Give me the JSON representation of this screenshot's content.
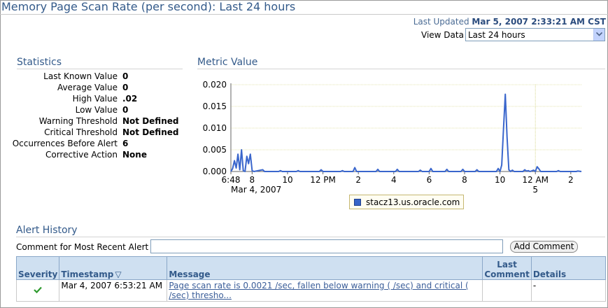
{
  "page": {
    "title": "Memory Page Scan Rate (per second): Last 24 hours",
    "last_updated_label": "Last Updated",
    "last_updated_value": "Mar 5, 2007 2:33:21 AM CST",
    "view_data_label": "View Data",
    "view_data_selected": "Last 24 hours"
  },
  "statistics": {
    "heading": "Statistics",
    "rows": [
      {
        "label": "Last Known Value",
        "value": "0"
      },
      {
        "label": "Average Value",
        "value": "0"
      },
      {
        "label": "High Value",
        "value": ".02"
      },
      {
        "label": "Low Value",
        "value": "0"
      },
      {
        "label": "Warning Threshold",
        "value": "Not Defined"
      },
      {
        "label": "Critical Threshold",
        "value": "Not Defined"
      },
      {
        "label": "Occurrences Before Alert",
        "value": "6"
      },
      {
        "label": "Corrective Action",
        "value": "None"
      }
    ]
  },
  "metric": {
    "heading": "Metric Value"
  },
  "chart_data": {
    "type": "line",
    "title": "",
    "xlabel": "",
    "ylabel": "",
    "ylim": [
      0,
      0.02
    ],
    "yticks": [
      "0.020",
      "0.015",
      "0.010",
      "0.005",
      "0.000"
    ],
    "xtick_labels": [
      {
        "top": "6:48",
        "bottom": "Mar 4, 2007",
        "hour": 6.8
      },
      {
        "top": "8",
        "bottom": "",
        "hour": 8
      },
      {
        "top": "10",
        "bottom": "",
        "hour": 10
      },
      {
        "top": "12 PM",
        "bottom": "",
        "hour": 12
      },
      {
        "top": "2",
        "bottom": "",
        "hour": 14
      },
      {
        "top": "4",
        "bottom": "",
        "hour": 16
      },
      {
        "top": "6",
        "bottom": "",
        "hour": 18
      },
      {
        "top": "8",
        "bottom": "",
        "hour": 20
      },
      {
        "top": "10",
        "bottom": "",
        "hour": 22
      },
      {
        "top": "12 AM",
        "bottom": "5",
        "hour": 24
      },
      {
        "top": "2",
        "bottom": "",
        "hour": 26
      }
    ],
    "xlim_hours": [
      6.8,
      26.6
    ],
    "day_marker_hour": 24,
    "legend_position": "bottom",
    "grid": true,
    "series": [
      {
        "name": "stacz13.us.oracle.com",
        "color": "#3a66cc",
        "points": [
          [
            6.8,
            0
          ],
          [
            6.9,
            0.0007
          ],
          [
            7.0,
            0.0025
          ],
          [
            7.1,
            0.0008
          ],
          [
            7.2,
            0.004
          ],
          [
            7.3,
            0.0004
          ],
          [
            7.4,
            0.005
          ],
          [
            7.5,
            0.0002
          ],
          [
            7.6,
            0
          ],
          [
            7.7,
            0.0035
          ],
          [
            7.8,
            0.0018
          ],
          [
            7.9,
            0.004
          ],
          [
            8.0,
            0.0002
          ],
          [
            8.1,
            0
          ],
          [
            8.6,
            0.0004
          ],
          [
            8.7,
            0
          ],
          [
            9.5,
            0
          ],
          [
            9.6,
            0.0002
          ],
          [
            9.7,
            0
          ],
          [
            10.5,
            0
          ],
          [
            10.6,
            0.0002
          ],
          [
            10.7,
            0
          ],
          [
            11.8,
            0
          ],
          [
            11.9,
            0.0004
          ],
          [
            12.0,
            0
          ],
          [
            13.0,
            0
          ],
          [
            13.1,
            0.0002
          ],
          [
            13.2,
            0
          ],
          [
            13.7,
            0
          ],
          [
            13.8,
            0.0009
          ],
          [
            13.9,
            0
          ],
          [
            15.0,
            0
          ],
          [
            15.1,
            0.0005
          ],
          [
            15.2,
            0
          ],
          [
            16.1,
            0
          ],
          [
            16.2,
            0.0005
          ],
          [
            16.3,
            0
          ],
          [
            17.4,
            0
          ],
          [
            17.5,
            0.0003
          ],
          [
            17.6,
            0
          ],
          [
            18.0,
            0
          ],
          [
            18.1,
            0.0007
          ],
          [
            18.2,
            0
          ],
          [
            18.9,
            0
          ],
          [
            19.0,
            0.0005
          ],
          [
            19.1,
            0
          ],
          [
            19.8,
            0
          ],
          [
            19.9,
            0.0005
          ],
          [
            20.0,
            0
          ],
          [
            20.6,
            0
          ],
          [
            20.7,
            0.0004
          ],
          [
            20.8,
            0
          ],
          [
            21.8,
            0
          ],
          [
            21.9,
            0.0007
          ],
          [
            22.0,
            0
          ],
          [
            22.1,
            0.0015
          ],
          [
            22.2,
            0.01
          ],
          [
            22.3,
            0.0178
          ],
          [
            22.4,
            0.008
          ],
          [
            22.5,
            0.0004
          ],
          [
            22.6,
            0
          ],
          [
            22.7,
            0.0003
          ],
          [
            22.8,
            0
          ],
          [
            23.3,
            0
          ],
          [
            23.4,
            0.0004
          ],
          [
            23.5,
            0.0001
          ],
          [
            23.6,
            0.0002
          ],
          [
            23.7,
            0
          ],
          [
            23.9,
            0.0003
          ],
          [
            24.0,
            0
          ],
          [
            24.1,
            0.0011
          ],
          [
            24.2,
            0.0006
          ],
          [
            24.3,
            0
          ],
          [
            25.2,
            0
          ],
          [
            25.3,
            0.0002
          ],
          [
            25.4,
            0
          ],
          [
            26.3,
            0
          ],
          [
            26.4,
            0.0001
          ],
          [
            26.6,
            0
          ]
        ]
      }
    ]
  },
  "alert_history": {
    "heading": "Alert History",
    "comment_label": "Comment for Most Recent Alert",
    "comment_value": "",
    "add_comment_label": "Add Comment",
    "columns": [
      "Severity",
      "Timestamp",
      "Message",
      "Last Comment",
      "Details"
    ],
    "last_comment_line1": "Last",
    "last_comment_line2": "Comment",
    "sort_indicator": "▽",
    "rows": [
      {
        "severity_icon": "checkmark-icon",
        "severity_color": "#2e9a2e",
        "timestamp": "Mar 4, 2007 6:53:21 AM",
        "message": "Page scan rate is 0.0021 /sec, fallen below warning ( /sec) and critical ( /sec) thresho...",
        "last_comment": "",
        "details": "-"
      }
    ]
  }
}
